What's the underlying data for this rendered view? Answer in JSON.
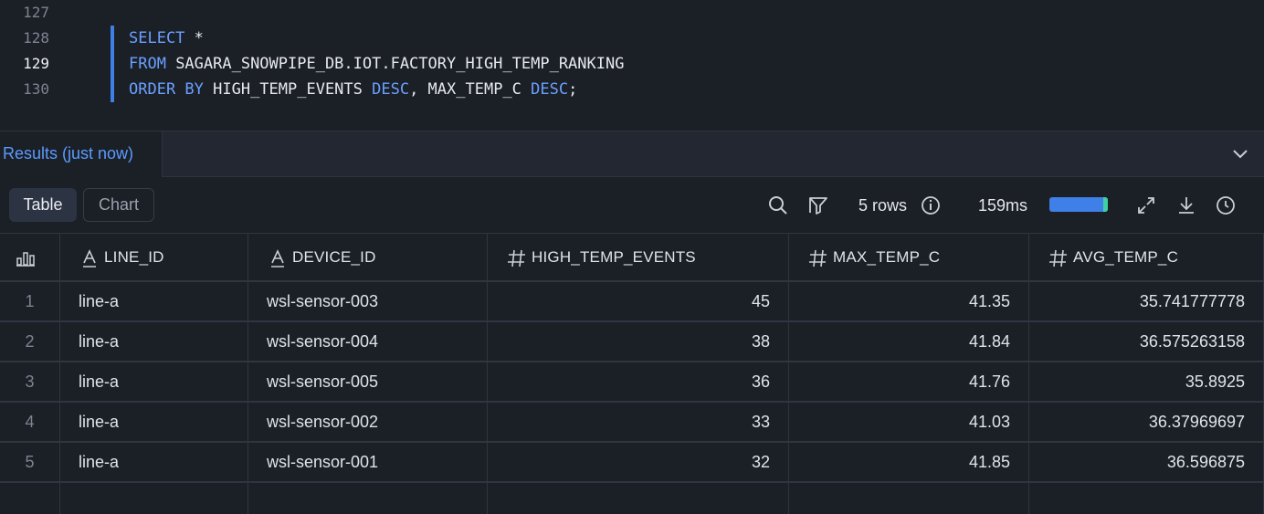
{
  "editor": {
    "lines": [
      {
        "no": "127",
        "active": false,
        "parts": []
      },
      {
        "no": "128",
        "active": false,
        "parts": [
          {
            "t": "SELECT",
            "kw": true
          },
          {
            "t": " *",
            "kw": false
          }
        ]
      },
      {
        "no": "129",
        "active": true,
        "parts": [
          {
            "t": "FROM",
            "kw": true
          },
          {
            "t": " SAGARA_SNOWPIPE_DB.IOT.FACTORY_HIGH_TEMP_RANKING",
            "kw": false
          }
        ]
      },
      {
        "no": "130",
        "active": false,
        "parts": [
          {
            "t": "ORDER BY",
            "kw": true
          },
          {
            "t": " HIGH_TEMP_EVENTS ",
            "kw": false
          },
          {
            "t": "DESC",
            "kw": true
          },
          {
            "t": ", MAX_TEMP_C ",
            "kw": false
          },
          {
            "t": "DESC",
            "kw": true
          },
          {
            "t": ";",
            "kw": false
          }
        ]
      }
    ]
  },
  "results": {
    "tab_label": "Results (just now)",
    "collapse_icon": "chevron-down-icon"
  },
  "toolbar": {
    "table_label": "Table",
    "chart_label": "Chart",
    "rows_label": "5 rows",
    "time_label": "159ms",
    "progress": 1.0
  },
  "table": {
    "columns": [
      {
        "label": "LINE_ID",
        "type": "text"
      },
      {
        "label": "DEVICE_ID",
        "type": "text"
      },
      {
        "label": "HIGH_TEMP_EVENTS",
        "type": "number"
      },
      {
        "label": "MAX_TEMP_C",
        "type": "number"
      },
      {
        "label": "AVG_TEMP_C",
        "type": "number"
      }
    ],
    "rows": [
      [
        "1",
        "line-a",
        "wsl-sensor-003",
        "45",
        "41.35",
        "35.741777778"
      ],
      [
        "2",
        "line-a",
        "wsl-sensor-004",
        "38",
        "41.84",
        "36.575263158"
      ],
      [
        "3",
        "line-a",
        "wsl-sensor-005",
        "36",
        "41.76",
        "35.8925"
      ],
      [
        "4",
        "line-a",
        "wsl-sensor-002",
        "33",
        "41.03",
        "36.37969697"
      ],
      [
        "5",
        "line-a",
        "wsl-sensor-001",
        "32",
        "41.85",
        "36.596875"
      ]
    ]
  },
  "colors": {
    "accent": "#3f7fe8",
    "keyword": "#6aa0ff",
    "progress_end": "#3fd1a1"
  }
}
